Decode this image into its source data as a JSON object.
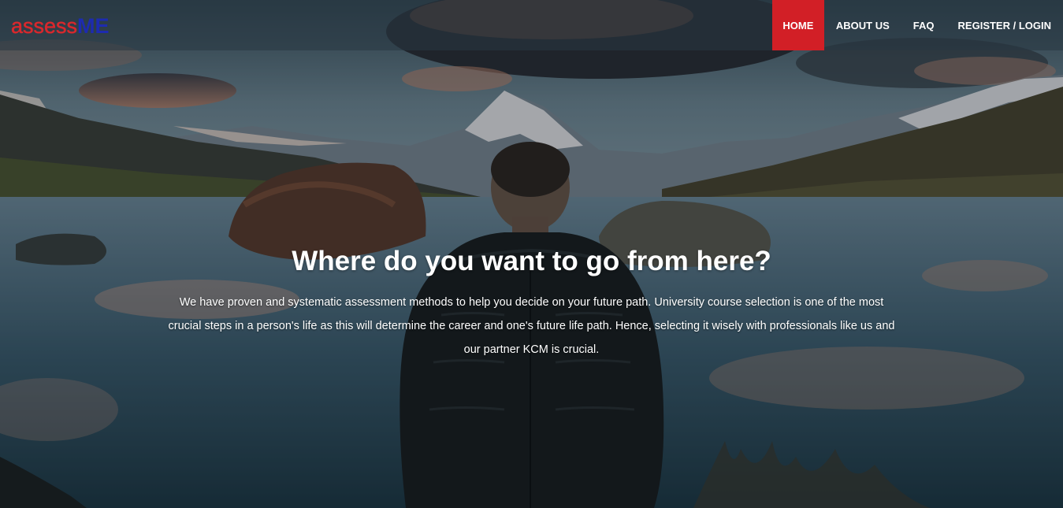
{
  "brand": {
    "logo_part1": "assess",
    "logo_part2": "ME",
    "colors": {
      "accent_red": "#d21f26",
      "logo_blue": "#1d2bb0"
    }
  },
  "nav": {
    "items": [
      {
        "label": "HOME",
        "active": true
      },
      {
        "label": "ABOUT US",
        "active": false
      },
      {
        "label": "FAQ",
        "active": false
      },
      {
        "label": "REGISTER / LOGIN",
        "active": false
      }
    ]
  },
  "hero": {
    "headline": "Where do you want to go from here?",
    "intro": "We have proven and systematic assessment methods to help you decide on your future path. University course selection is one of the most crucial steps in a person's life as this will determine the career and one's future life path. Hence, selecting it wisely with professionals like us and our partner KCM is crucial."
  }
}
